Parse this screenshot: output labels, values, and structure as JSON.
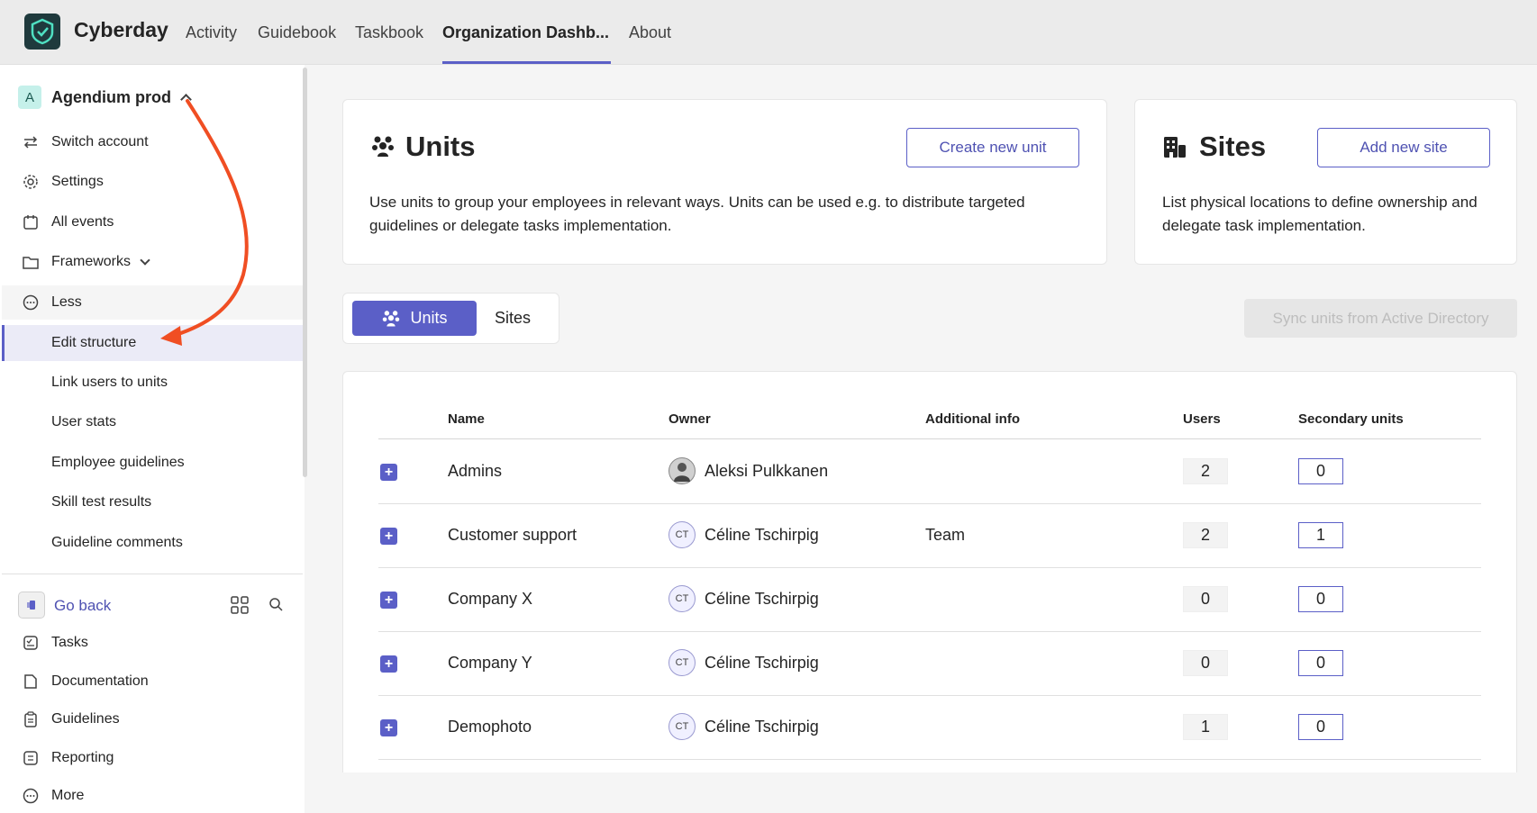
{
  "app": {
    "name": "Cyberday"
  },
  "nav": {
    "tabs": [
      {
        "label": "Activity"
      },
      {
        "label": "Guidebook"
      },
      {
        "label": "Taskbook"
      },
      {
        "label": "Organization Dashb..."
      },
      {
        "label": "About"
      }
    ]
  },
  "sidebar": {
    "account_badge": "A",
    "account_name": "Agendium prod",
    "items": [
      {
        "label": "Switch account",
        "icon": "switch-arrows-icon"
      },
      {
        "label": "Settings",
        "icon": "gear-icon"
      },
      {
        "label": "All events",
        "icon": "calendar-icon"
      },
      {
        "label": "Frameworks",
        "icon": "folder-icon"
      },
      {
        "label": "Less",
        "icon": "more-circle-icon"
      }
    ],
    "subitems": [
      {
        "label": "Edit structure"
      },
      {
        "label": "Link users to units"
      },
      {
        "label": "User stats"
      },
      {
        "label": "Employee guidelines"
      },
      {
        "label": "Skill test results"
      },
      {
        "label": "Guideline comments"
      }
    ],
    "go_back": "Go back",
    "bottom_items": [
      {
        "label": "Tasks",
        "icon": "tasks-icon"
      },
      {
        "label": "Documentation",
        "icon": "document-icon"
      },
      {
        "label": "Guidelines",
        "icon": "clipboard-icon"
      },
      {
        "label": "Reporting",
        "icon": "report-icon"
      },
      {
        "label": "More",
        "icon": "more-circle-icon"
      }
    ]
  },
  "units_card": {
    "title": "Units",
    "button": "Create new unit",
    "text": "Use units to group your employees in relevant ways. Units can be used e.g. to distribute targeted guidelines or delegate tasks implementation."
  },
  "sites_card": {
    "title": "Sites",
    "button": "Add new site",
    "text": "List physical locations to define ownership and delegate task implementation."
  },
  "segment": {
    "active": "Units",
    "inactive": "Sites"
  },
  "sync_button": "Sync units from Active Directory",
  "table": {
    "headers": [
      "Name",
      "Owner",
      "Additional info",
      "Users",
      "Secondary units"
    ],
    "rows": [
      {
        "name": "Admins",
        "owner": "Aleksi Pulkkanen",
        "initials": "",
        "info": "",
        "users": "2",
        "secondary": "0"
      },
      {
        "name": "Customer support",
        "owner": "Céline Tschirpig",
        "initials": "CT",
        "info": "Team",
        "users": "2",
        "secondary": "1"
      },
      {
        "name": "Company X",
        "owner": "Céline Tschirpig",
        "initials": "CT",
        "info": "",
        "users": "0",
        "secondary": "0"
      },
      {
        "name": "Company Y",
        "owner": "Céline Tschirpig",
        "initials": "CT",
        "info": "",
        "users": "0",
        "secondary": "0"
      },
      {
        "name": "Demophoto",
        "owner": "Céline Tschirpig",
        "initials": "CT",
        "info": "",
        "users": "1",
        "secondary": "0"
      }
    ]
  },
  "colors": {
    "accent": "#5b5fc7",
    "annotation_arrow": "#f04e23"
  }
}
